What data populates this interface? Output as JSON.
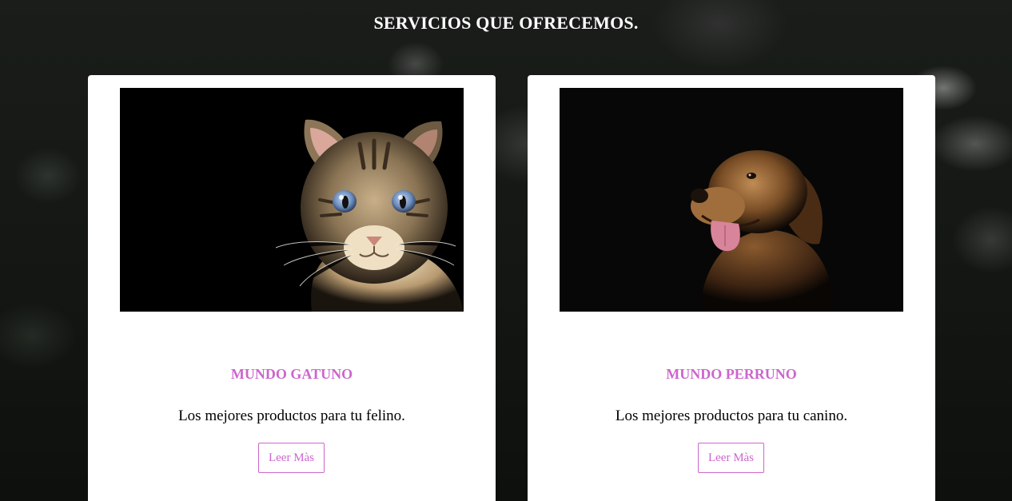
{
  "section": {
    "title": "SERVICIOS QUE OFRECEMOS."
  },
  "colors": {
    "accent": "#cc66cc",
    "card_background": "#ffffff",
    "page_background": "#151815"
  },
  "cards": [
    {
      "image": "cat-photo",
      "title": "MUNDO GATUNO",
      "text": "Los mejores productos para tu felino.",
      "button_label": "Leer Màs"
    },
    {
      "image": "dog-photo",
      "title": "MUNDO PERRUNO",
      "text": "Los mejores productos para tu canino.",
      "button_label": "Leer Màs"
    }
  ]
}
